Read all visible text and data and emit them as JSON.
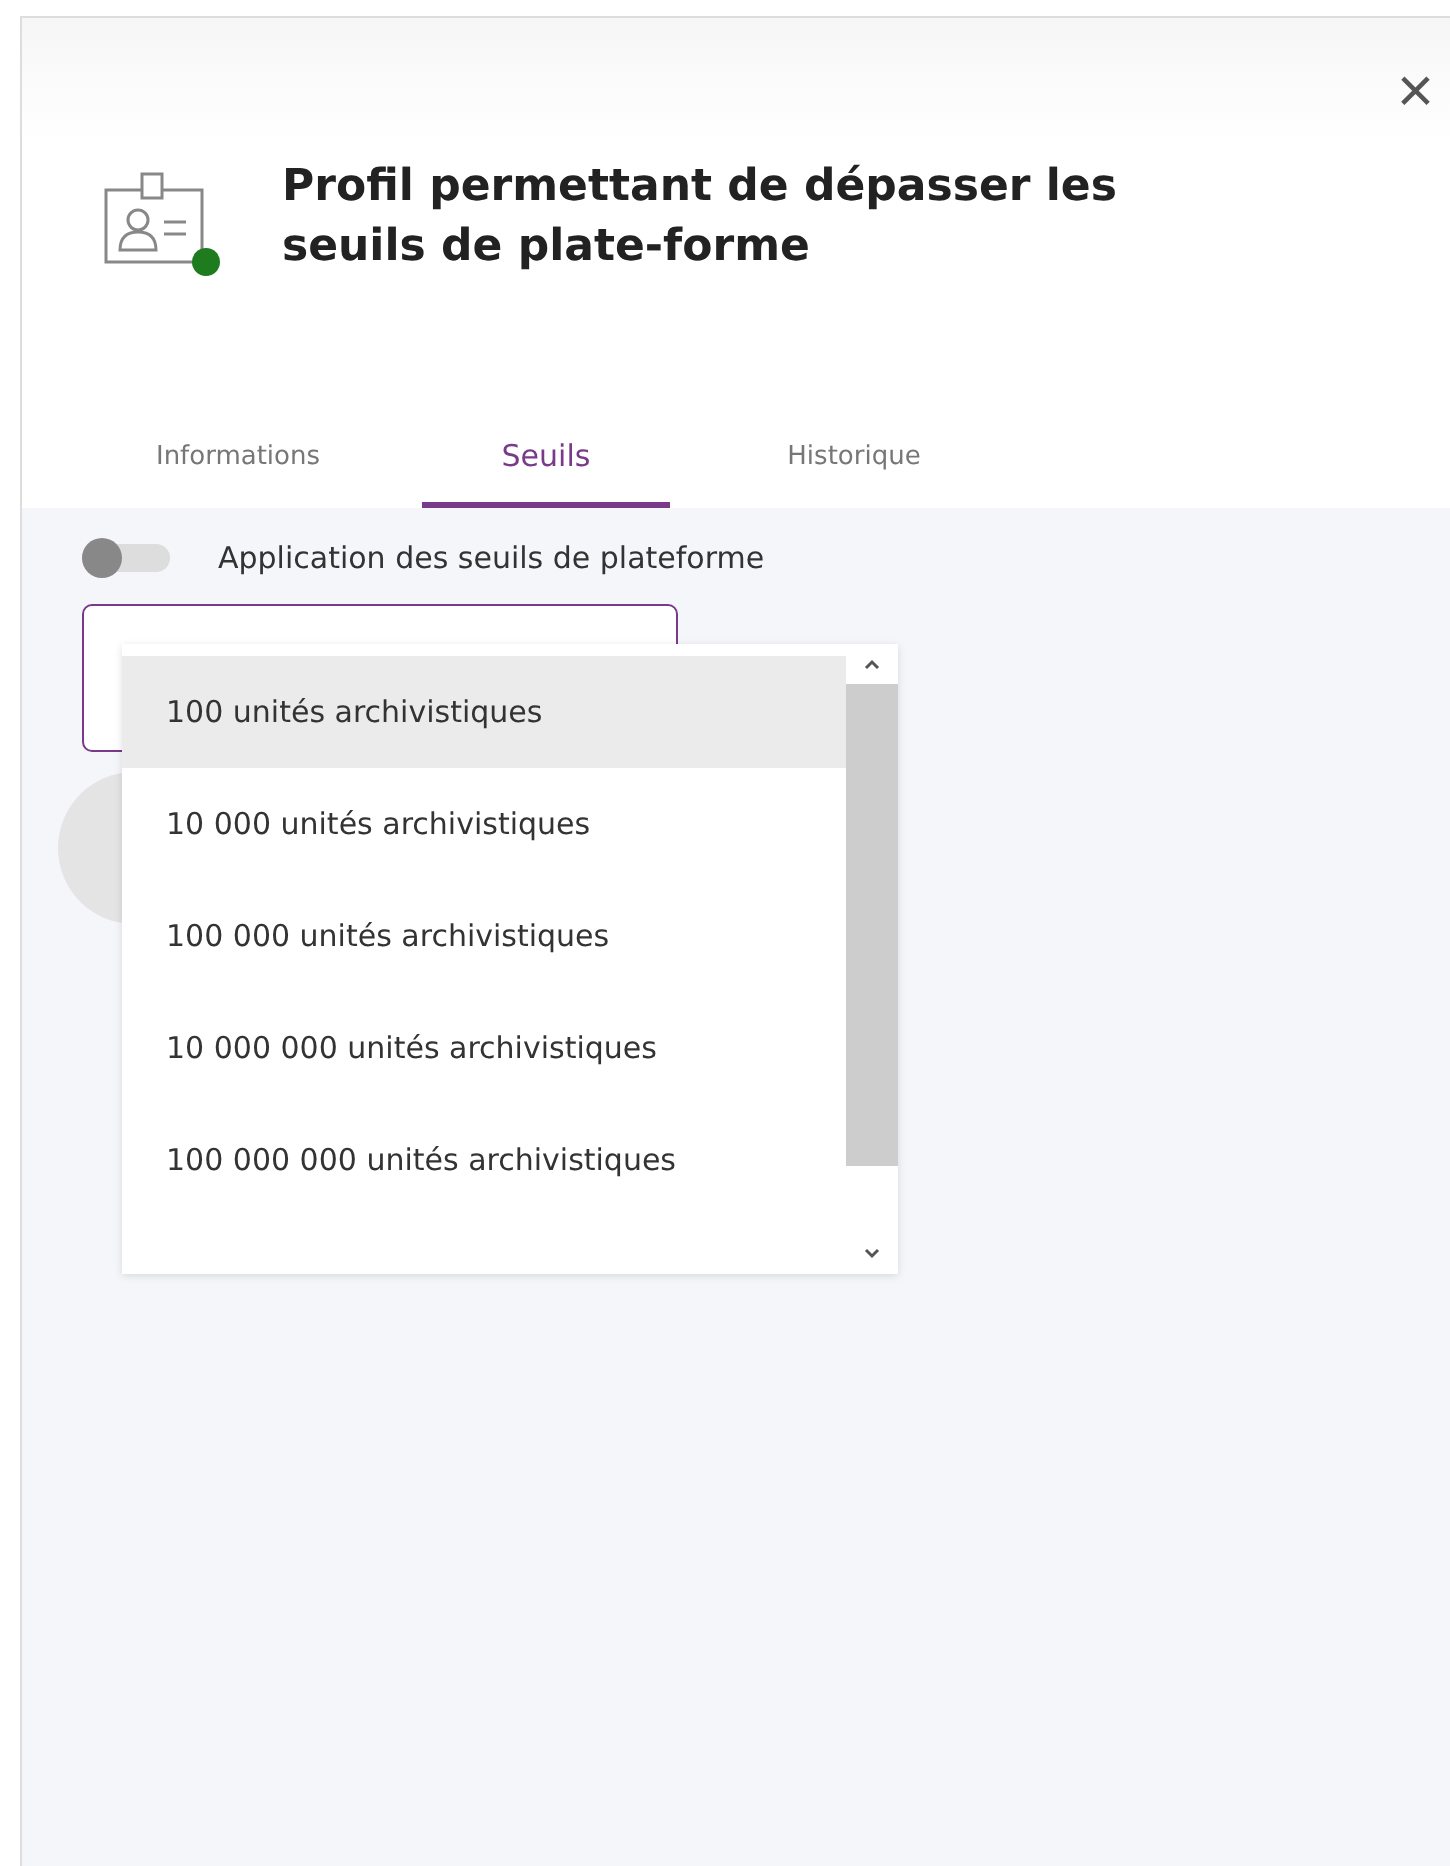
{
  "dialog": {
    "title": "Profil permettant de dépasser les seuils de plate-forme",
    "close": "×"
  },
  "tabs": [
    {
      "label": "Informations",
      "selected": false
    },
    {
      "label": "Seuils",
      "selected": true
    },
    {
      "label": "Historique",
      "selected": false
    }
  ],
  "toggle": {
    "label": "Application des seuils de plateforme",
    "on": false
  },
  "dropdown": {
    "options": [
      {
        "label": "100 unités archivistiques",
        "selected": true
      },
      {
        "label": "10 000 unités archivistiques",
        "selected": false
      },
      {
        "label": "100 000 unités archivistiques",
        "selected": false
      },
      {
        "label": "10 000 000 unités archivistiques",
        "selected": false
      },
      {
        "label": "100 000 000 unités archivistiques",
        "selected": false
      }
    ]
  }
}
